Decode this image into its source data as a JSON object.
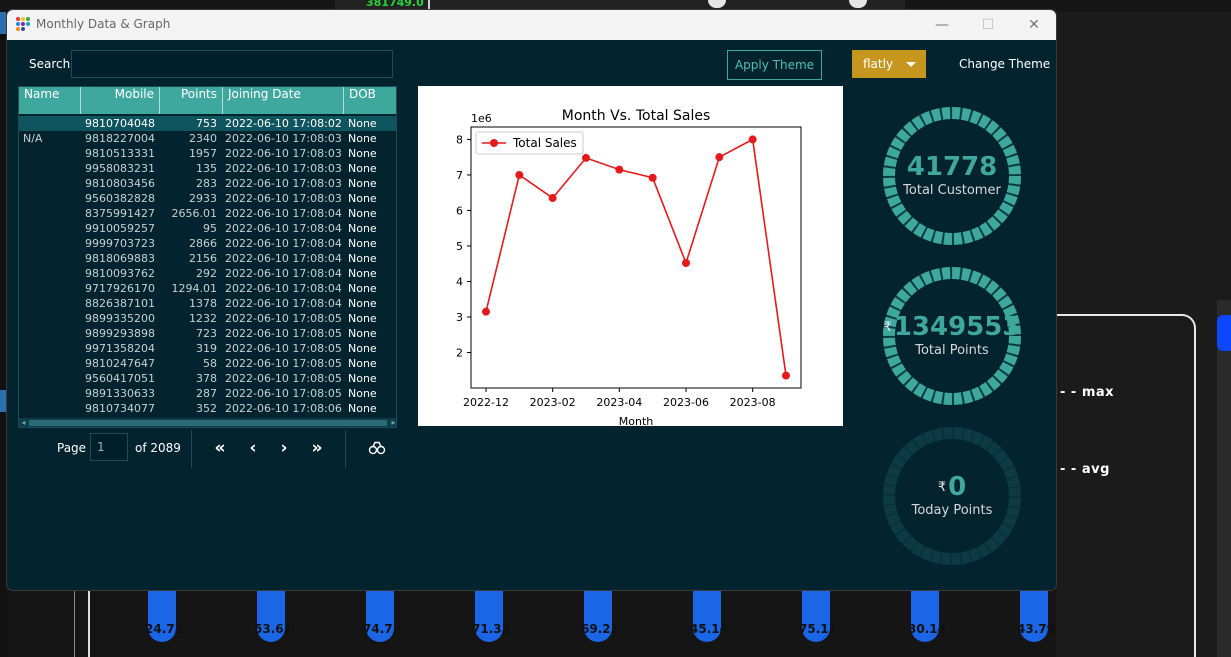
{
  "background": {
    "top_value": "381749.0",
    "labels": [
      "max",
      "avg"
    ],
    "bar_labels": [
      "24.73",
      "53.61",
      "74.7",
      "71.33",
      "69.21",
      "45.14",
      "75.11",
      "30.14",
      "43.79"
    ]
  },
  "window": {
    "title": "Monthly Data & Graph",
    "minimize": "—",
    "maximize": "☐",
    "close": "✕"
  },
  "toolbar": {
    "search_label": "Search",
    "search_value": "",
    "apply_theme": "Apply Theme",
    "theme_value": "flatly",
    "change_theme": "Change Theme"
  },
  "table": {
    "headers": [
      "Name",
      "Mobile",
      "Points",
      "Joining Date",
      "DOB"
    ],
    "rows": [
      [
        "",
        "9810704048",
        "753",
        "2022-06-10 17:08:02",
        "None"
      ],
      [
        "N/A",
        "9818227004",
        "2340",
        "2022-06-10 17:08:03",
        "None"
      ],
      [
        "",
        "9810513331",
        "1957",
        "2022-06-10 17:08:03",
        "None"
      ],
      [
        "",
        "9958083231",
        "135",
        "2022-06-10 17:08:03",
        "None"
      ],
      [
        "",
        "9810803456",
        "283",
        "2022-06-10 17:08:03",
        "None"
      ],
      [
        "",
        "9560382828",
        "2933",
        "2022-06-10 17:08:03",
        "None"
      ],
      [
        "",
        "8375991427",
        "2656.01",
        "2022-06-10 17:08:04",
        "None"
      ],
      [
        "",
        "9910059257",
        "95",
        "2022-06-10 17:08:04",
        "None"
      ],
      [
        "",
        "9999703723",
        "2866",
        "2022-06-10 17:08:04",
        "None"
      ],
      [
        "",
        "9818069883",
        "2156",
        "2022-06-10 17:08:04",
        "None"
      ],
      [
        "",
        "9810093762",
        "292",
        "2022-06-10 17:08:04",
        "None"
      ],
      [
        "",
        "9717926170",
        "1294.01",
        "2022-06-10 17:08:04",
        "None"
      ],
      [
        "",
        "8826387101",
        "1378",
        "2022-06-10 17:08:04",
        "None"
      ],
      [
        "",
        "9899335200",
        "1232",
        "2022-06-10 17:08:05",
        "None"
      ],
      [
        "",
        "9899293898",
        "723",
        "2022-06-10 17:08:05",
        "None"
      ],
      [
        "",
        "9971358204",
        "319",
        "2022-06-10 17:08:05",
        "None"
      ],
      [
        "",
        "9810247647",
        "58",
        "2022-06-10 17:08:05",
        "None"
      ],
      [
        "",
        "9560417051",
        "378",
        "2022-06-10 17:08:05",
        "None"
      ],
      [
        "",
        "9891330633",
        "287",
        "2022-06-10 17:08:05",
        "None"
      ],
      [
        "",
        "9810734077",
        "352",
        "2022-06-10 17:08:06",
        "None"
      ]
    ]
  },
  "pagination": {
    "page_label": "Page",
    "page_value": "1",
    "of_label": "of 2089",
    "first": "«",
    "prev": "‹",
    "next": "›",
    "last": "»"
  },
  "meters": [
    {
      "value": "41778",
      "currency": "",
      "label": "Total Customer",
      "fill": 1.0,
      "active": true
    },
    {
      "value": "1349553",
      "currency": "₹",
      "label": "Total Points",
      "fill": 1.0,
      "active": true
    },
    {
      "value": "0",
      "currency": "₹",
      "label": "Today Points",
      "fill": 0.0,
      "active": false
    }
  ],
  "colors": {
    "accent": "#3ea89f",
    "window_bg": "#03232f",
    "theme_select": "#c7961e",
    "meter_inactive": "#0d3a45",
    "series": "#e41a1c"
  },
  "chart_data": {
    "type": "line",
    "title": "Month Vs. Total Sales",
    "xlabel": "Month",
    "ylabel": "",
    "y_multiplier_label": "1e6",
    "legend": "top-left",
    "series": [
      {
        "name": "Total Sales",
        "x": [
          "2022-12",
          "2023-01",
          "2023-02",
          "2023-03",
          "2023-04",
          "2023-05",
          "2023-06",
          "2023-07",
          "2023-08",
          "2023-09"
        ],
        "values": [
          3.15,
          7.0,
          6.35,
          7.48,
          7.15,
          6.92,
          4.52,
          7.5,
          8.0,
          1.35
        ]
      }
    ],
    "x_ticks": [
      "2022-12",
      "2023-02",
      "2023-04",
      "2023-06",
      "2023-08"
    ],
    "y_ticks": [
      2,
      3,
      4,
      5,
      6,
      7,
      8
    ],
    "ylim": [
      1.0,
      8.35
    ],
    "grid": false
  }
}
